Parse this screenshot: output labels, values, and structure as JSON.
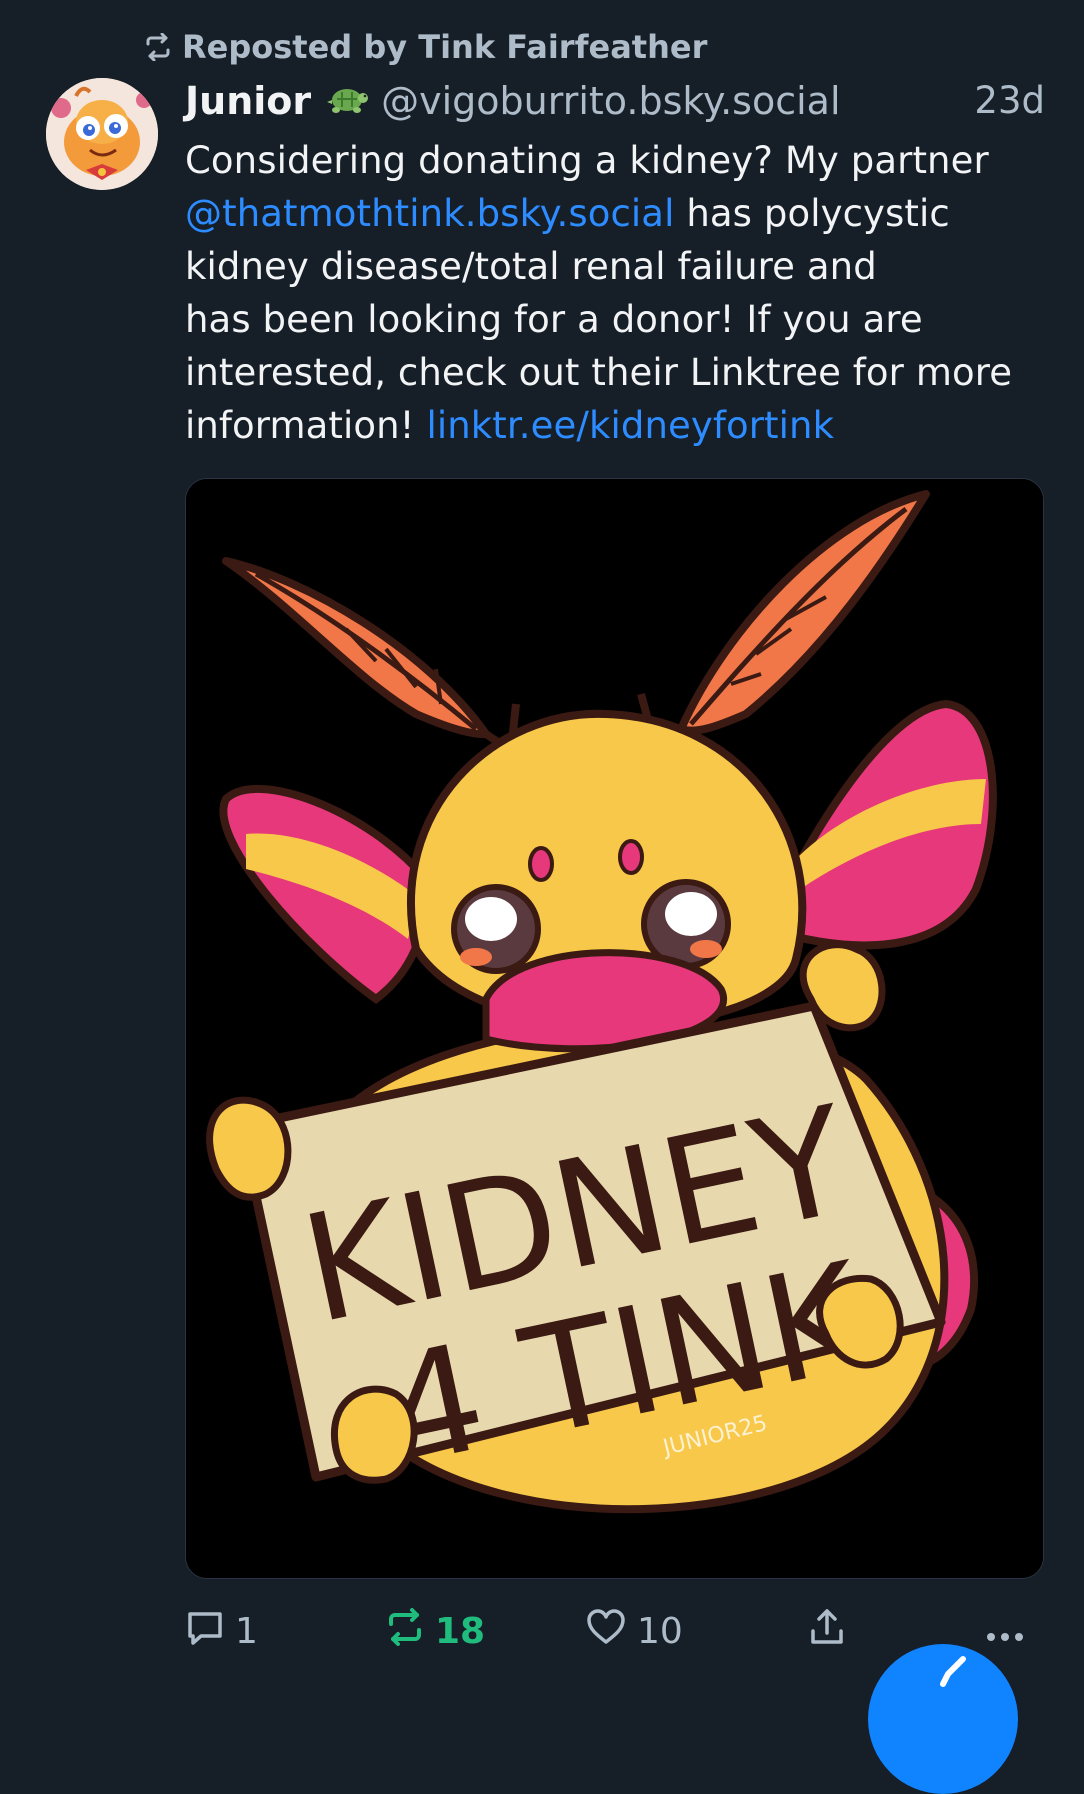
{
  "repost": {
    "label": "Reposted by Tink Fairfeather",
    "icon": "repost-icon"
  },
  "post": {
    "author": {
      "display_name": "Junior",
      "badge_icon": "turtle-emoji",
      "handle": "@vigoburrito.bsky.social"
    },
    "timestamp": "23d",
    "text": {
      "line1": "Considering donating a kidney? My partner",
      "mention": "@thatmothtink.bsky.social",
      "line2_rest": " has polycystic",
      "line3": "kidney disease/total renal failure and",
      "line4": "has been looking for a donor! If you are",
      "line5": "interested, check out their Linktree for more",
      "line6_start": "information! ",
      "link": "linktr.ee/kidneyfortink"
    },
    "image": {
      "sign_line1": "KIDNEY",
      "sign_line2": "4 TINK",
      "signature": "JUNIOR25"
    },
    "actions": {
      "replies": "1",
      "reposts": "18",
      "likes": "10"
    }
  },
  "colors": {
    "background": "#161e27",
    "muted": "#aebbc9",
    "link": "#2d8cff",
    "repost_active": "#20bc7e",
    "fab": "#1083fe"
  }
}
